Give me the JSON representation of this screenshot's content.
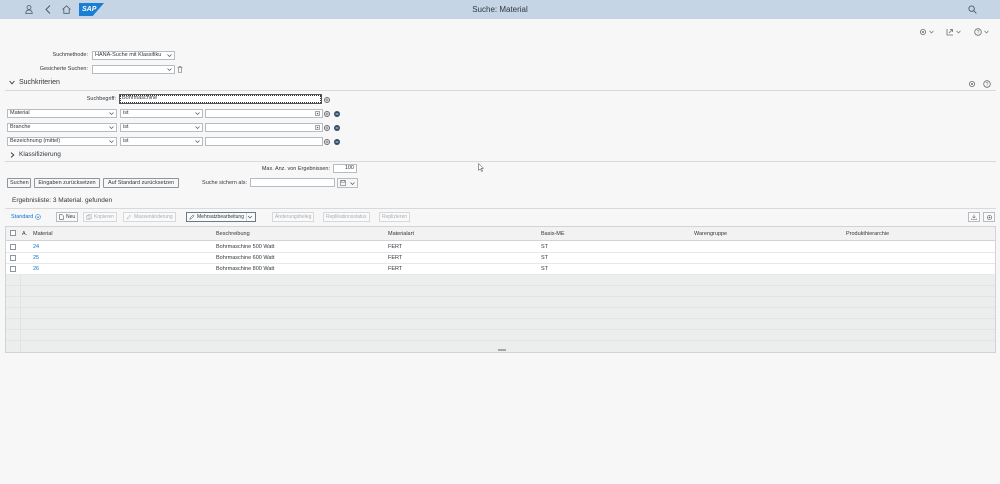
{
  "shell": {
    "title": "Suche: Material",
    "logo": "SAP",
    "icons": [
      "user-icon",
      "back-icon",
      "home-icon",
      "search-icon"
    ]
  },
  "subtoolbar": {
    "icons": [
      "settings-icon",
      "export-icon",
      "help-icon"
    ]
  },
  "form": {
    "suchmethode_label": "Suchmethode:",
    "suchmethode_value": "HANA-Suche mit Klassifiku",
    "gesicherte_label": "Gesicherte Suchen:",
    "gesicherte_value": ""
  },
  "criteria": {
    "title": "Suchkriterien",
    "suchbegriff_label": "Suchbegriff:",
    "suchbegriff_value": "Bohrmaschine",
    "rows": [
      {
        "field": "Material",
        "operator": "ist",
        "value": ""
      },
      {
        "field": "Branche",
        "operator": "ist",
        "value": ""
      },
      {
        "field": "Bezeichnung (mittel)",
        "operator": "ist",
        "value": ""
      }
    ],
    "klassifizierung": "Klassifizierung",
    "max_label": "Max. Anz. von Ergebnissen:",
    "max_value": "100"
  },
  "buttons": {
    "suchen": "Suchen",
    "eingaben_reset": "Eingaben zurücksetzen",
    "standard_reset": "Auf Standard zurücksetzen",
    "suche_sichern_label": "Suche sichern als:",
    "suche_sichern_value": ""
  },
  "results": {
    "title": "Ergebnisliste: 3 Material. gefunden",
    "variant": "Standard",
    "toolbar": {
      "neu": "Neu",
      "kopieren": "Kopieren",
      "massenaenderung": "Massenänderung",
      "mehrsatz": "Mehrsatzbearbeitung",
      "aenderungsbeleg": "Änderungsbeleg",
      "replikationsstatus": "Replikationsstatus",
      "replizieren": "Replizieren"
    },
    "columns": [
      "A.",
      "Material",
      "Beschreibung",
      "Materialart",
      "Basis-ME",
      "Warengruppe",
      "Produkthierarchie"
    ],
    "rows": [
      {
        "material": "24",
        "beschreibung": "Bohrmaschine 500 Watt",
        "materialart": "FERT",
        "basisme": "ST",
        "warengruppe": "",
        "produkthierarchie": ""
      },
      {
        "material": "25",
        "beschreibung": "Bohrmaschine 600 Watt",
        "materialart": "FERT",
        "basisme": "ST",
        "warengruppe": "",
        "produkthierarchie": ""
      },
      {
        "material": "26",
        "beschreibung": "Bohrmaschine 800 Watt",
        "materialart": "FERT",
        "basisme": "ST",
        "warengruppe": "",
        "produkthierarchie": ""
      }
    ]
  },
  "colors": {
    "shell_bg": "#c5d5e6",
    "link": "#0a6ed1",
    "remove": "#2c4e6c"
  }
}
